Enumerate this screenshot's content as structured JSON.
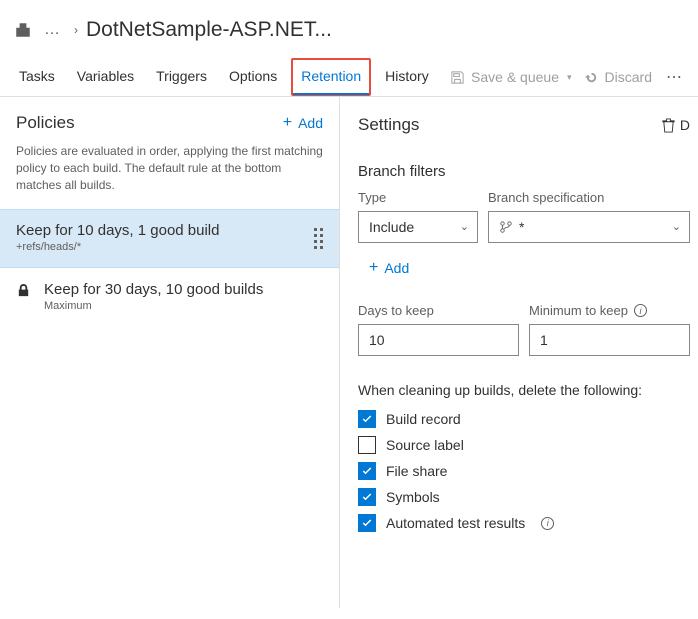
{
  "header": {
    "title": "DotNetSample-ASP.NET..."
  },
  "tabs": {
    "items": [
      "Tasks",
      "Variables",
      "Triggers",
      "Options",
      "Retention",
      "History"
    ],
    "active": "Retention",
    "save_label": "Save & queue",
    "discard_label": "Discard"
  },
  "policies": {
    "heading": "Policies",
    "add_label": "Add",
    "description": "Policies are evaluated in order, applying the first matching policy to each build. The default rule at the bottom matches all builds.",
    "items": [
      {
        "title": "Keep for 10 days, 1 good build",
        "subtitle": "+refs/heads/*",
        "selected": true,
        "locked": false
      },
      {
        "title": "Keep for 30 days, 10 good builds",
        "subtitle": "Maximum",
        "selected": false,
        "locked": true
      }
    ]
  },
  "settings": {
    "heading": "Settings",
    "delete_label": "D",
    "branch_filters_heading": "Branch filters",
    "type_label": "Type",
    "branch_spec_label": "Branch specification",
    "type_value": "Include",
    "branch_value": "*",
    "add_label": "Add",
    "days_label": "Days to keep",
    "days_value": "10",
    "min_label": "Minimum to keep",
    "min_value": "1",
    "cleanup_heading": "When cleaning up builds, delete the following:",
    "checks": [
      {
        "label": "Build record",
        "checked": true,
        "info": false
      },
      {
        "label": "Source label",
        "checked": false,
        "info": false
      },
      {
        "label": "File share",
        "checked": true,
        "info": false
      },
      {
        "label": "Symbols",
        "checked": true,
        "info": false
      },
      {
        "label": "Automated test results",
        "checked": true,
        "info": true
      }
    ]
  }
}
